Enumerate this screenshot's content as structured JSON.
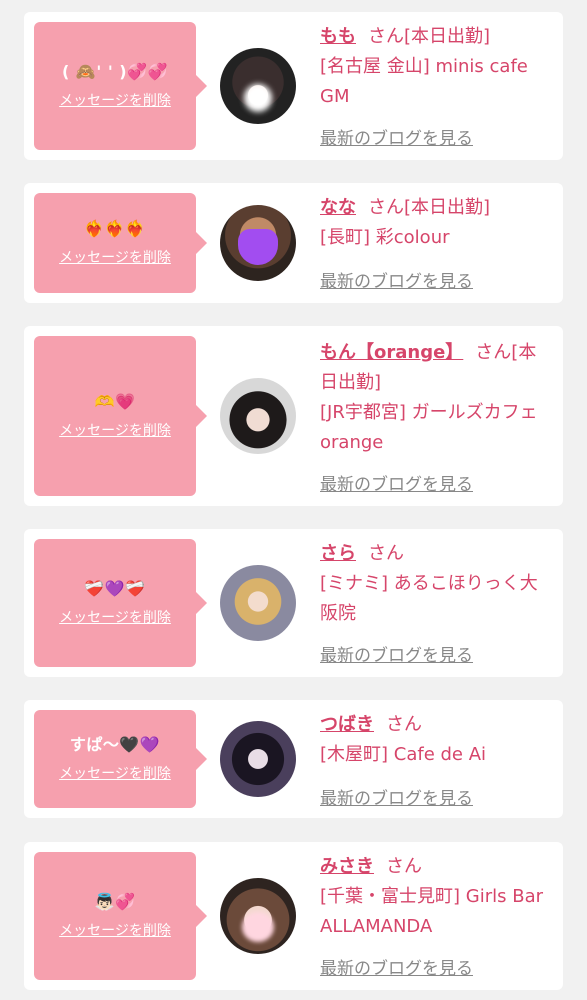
{
  "cards": [
    {
      "message": "( 🙈' ' )💞💞",
      "delete_label": "メッセージを削除",
      "name": "もも",
      "honorific": "さん",
      "status": "[本日出勤]",
      "shop": "[名古屋 金山] minis cafe GM",
      "blog_label": "最新のブログを見る"
    },
    {
      "message": "❤️‍🔥❤️‍🔥❤️‍🔥",
      "delete_label": "メッセージを削除",
      "name": "なな",
      "honorific": "さん",
      "status": "[本日出勤]",
      "shop": "[長町] 彩colour",
      "blog_label": "最新のブログを見る"
    },
    {
      "message": "🫶💗",
      "delete_label": "メッセージを削除",
      "name": "もん【orange】",
      "honorific": "さん",
      "status": "[本日出勤]",
      "shop": "[JR宇都宮] ガールズカフェ orange",
      "blog_label": "最新のブログを見る"
    },
    {
      "message": "❤️‍🩹💜❤️‍🩹",
      "delete_label": "メッセージを削除",
      "name": "さら",
      "honorific": "さん",
      "status": "",
      "shop": "[ミナミ] あるこほりっく大阪院",
      "blog_label": "最新のブログを見る"
    },
    {
      "message": "すぱ〜🖤💜",
      "delete_label": "メッセージを削除",
      "name": "つばき",
      "honorific": "さん",
      "status": "",
      "shop": "[木屋町] Cafe de Ai",
      "blog_label": "最新のブログを見る"
    },
    {
      "message": "👼🏻💞",
      "delete_label": "メッセージを削除",
      "name": "みさき",
      "honorific": "さん",
      "status": "",
      "shop": "[千葉・富士見町] Girls Bar ALLAMANDA",
      "blog_label": "最新のブログを見る"
    }
  ],
  "colors": {
    "accent": "#d6456a",
    "message_bg": "#f6a0ae",
    "card_bg": "#ffffff",
    "page_bg": "#f1f1f1",
    "blog_link": "#888888"
  }
}
